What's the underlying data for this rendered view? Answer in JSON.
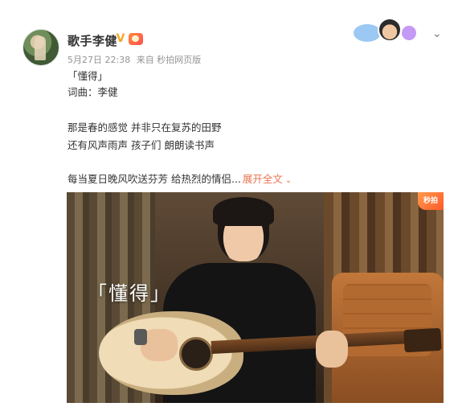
{
  "post": {
    "username": "歌手李健",
    "verified_icon": "verified-badge-icon",
    "meta": {
      "date": "5月27日 22:38",
      "source": "来自 秒拍网页版"
    },
    "lines": [
      "「懂得」",
      "词曲：李健",
      "",
      "那是春的感觉 并非只在复苏的田野",
      "还有风声雨声 孩子们 朗朗读书声",
      "",
      "每当夏日晚风吹送芬芳 给热烈的情侣..."
    ],
    "expand_label": "展开全文",
    "video": {
      "overlay_title": "「懂得」",
      "corner_tag": "秒拍"
    }
  },
  "colors": {
    "accent": "#eb7350",
    "meta": "#939393"
  }
}
